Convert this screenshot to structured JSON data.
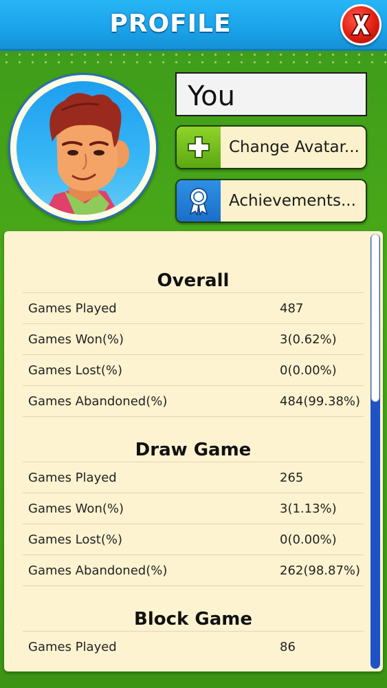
{
  "header": {
    "title": "PROFILE"
  },
  "profile": {
    "name": "You",
    "change_avatar_label": "Change Avatar...",
    "achievements_label": "Achievements..."
  },
  "colors": {
    "header_blue": "#1aa3ea",
    "close_red": "#e01e12",
    "panel_cream": "#fdf3d0",
    "scroll_blue": "#1e53c8"
  },
  "icons": {
    "close": "close-x-icon",
    "plus": "plus-icon",
    "award": "award-ribbon-icon"
  },
  "stats": [
    {
      "heading": "Overall",
      "rows": [
        {
          "label": "Games Played",
          "value": "487"
        },
        {
          "label": "Games Won(%)",
          "value": "3(0.62%)"
        },
        {
          "label": "Games Lost(%)",
          "value": "0(0.00%)"
        },
        {
          "label": "Games Abandoned(%)",
          "value": "484(99.38%)"
        }
      ]
    },
    {
      "heading": "Draw Game",
      "rows": [
        {
          "label": "Games Played",
          "value": "265"
        },
        {
          "label": "Games Won(%)",
          "value": "3(1.13%)"
        },
        {
          "label": "Games Lost(%)",
          "value": "0(0.00%)"
        },
        {
          "label": "Games Abandoned(%)",
          "value": "262(98.87%)"
        }
      ]
    },
    {
      "heading": "Block Game",
      "rows": [
        {
          "label": "Games Played",
          "value": "86"
        }
      ]
    }
  ]
}
